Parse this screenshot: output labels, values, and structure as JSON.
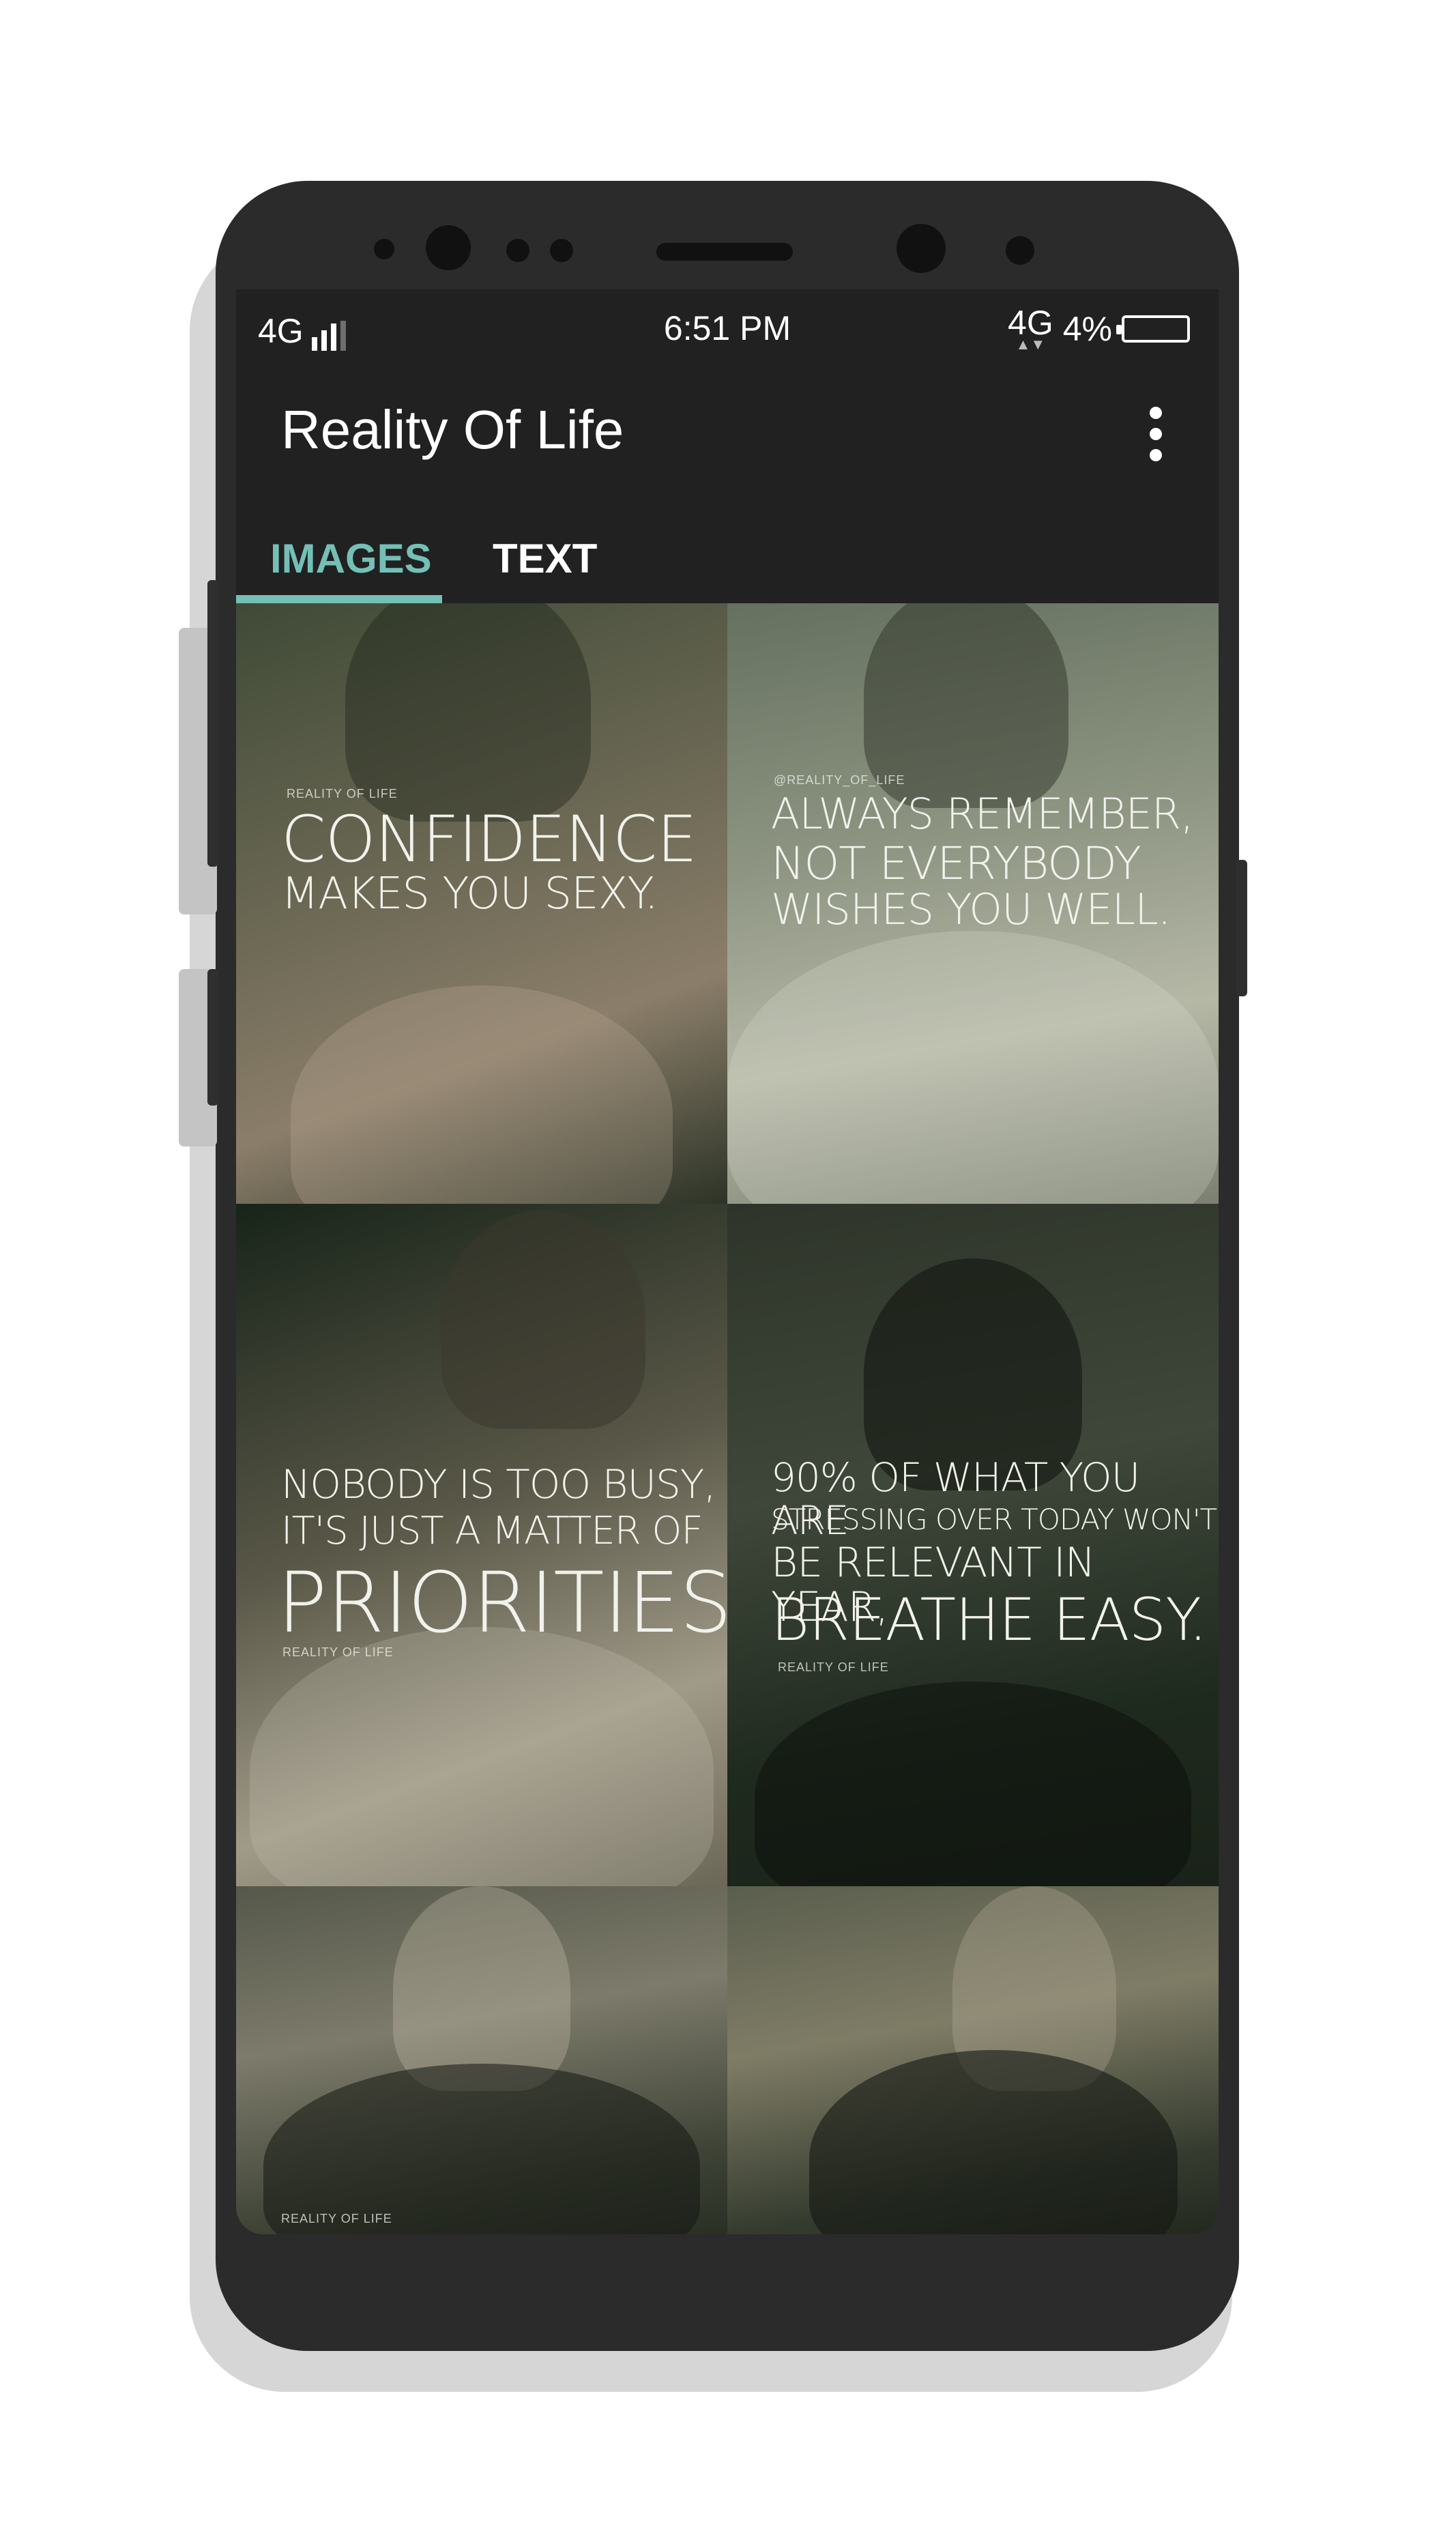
{
  "status_bar": {
    "network_left": "4G",
    "time": "6:51 PM",
    "network_right": "4G",
    "battery": "4%"
  },
  "app_bar": {
    "title": "Reality Of Life",
    "menu_icon": "more-vert-icon"
  },
  "tabs": [
    {
      "label": "IMAGES",
      "selected": true
    },
    {
      "label": "TEXT",
      "selected": false
    }
  ],
  "colors": {
    "accent": "#74bfb6",
    "background": "#212121",
    "phone_frame": "#2b2b2b"
  },
  "images": [
    {
      "watermark": "REALITY OF LIFE",
      "lines": [
        "CONFIDENCE",
        "MAKES YOU SEXY."
      ]
    },
    {
      "watermark": "@REALITY_OF_LIFE",
      "lines": [
        "ALWAYS REMEMBER,",
        "NOT EVERYBODY",
        "WISHES YOU WELL."
      ]
    },
    {
      "watermark": "REALITY OF LIFE",
      "lines": [
        "NOBODY IS TOO BUSY,",
        "IT'S JUST A MATTER OF",
        "PRIORITIES."
      ]
    },
    {
      "watermark": "REALITY OF LIFE",
      "lines": [
        "90% OF WHAT YOU ARE",
        "STRESSING OVER TODAY WON'T",
        "BE RELEVANT IN YEAR,",
        "BREATHE EASY."
      ]
    },
    {
      "watermark": "REALITY OF LIFE",
      "lines": []
    },
    {
      "watermark": "",
      "lines": []
    }
  ]
}
